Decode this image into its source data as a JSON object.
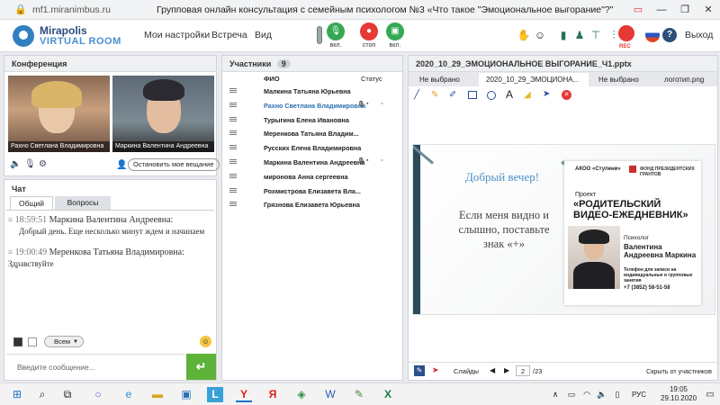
{
  "browser": {
    "url": "mf1.miranimbus.ru",
    "title": "Групповая онлайн консультация с семейным психологом №3 «Что такое \"Эмоциональное выгорание\"?\""
  },
  "app": {
    "logo_line1": "Mirapolis",
    "logo_line2": "VIRTUAL ROOM",
    "menu": [
      "Мои настройки",
      "Встреча",
      "Вид"
    ],
    "mic_label": "вкл.",
    "stop_label": "стоп",
    "cam_label": "вкл.",
    "rec_label": "REC",
    "exit_label": "Выход"
  },
  "conference": {
    "title": "Конференция",
    "videos": [
      "Рахно Светлана Владимировна",
      "Маркина Валентина Андреевна"
    ],
    "stop_broadcast": "Остановить мое вещание"
  },
  "chat": {
    "title": "Чат",
    "tabs": [
      "Общий",
      "Вопросы"
    ],
    "messages": [
      {
        "time": "18:59:51",
        "author": "Маркина Валентина  Андреевна:",
        "text": "Добрый день. Еще несколько минут ждем и начинаем"
      },
      {
        "time": "19:00:49",
        "author": "Меренкова  Татьяна Владимировна:",
        "text": "Здравствуйте"
      }
    ],
    "recipient": "Всем",
    "placeholder": "Введите сообщение..."
  },
  "participants": {
    "title": "Участники",
    "count": "9",
    "col_name": "ФИО",
    "col_status": "Статус",
    "list": [
      "Малкина Татьяна  Юрьевна",
      "Рахно Светлана  Владимировна",
      "Турыгина  Елена  Ивановна",
      "Меренкова  Татьяна  Владим...",
      "Русских Елена Владимировна",
      "Маркина Валентина  Андреевна",
      "миронова  Анна  сергеевна",
      "Рохмистрова  Елизавета Вла...",
      "Грязнова Елизавета  Юрьевна"
    ]
  },
  "presentation": {
    "title": "2020_10_29_ЭМОЦИОНАЛЬНОЕ ВЫГОРАНИЕ_Ч1.pptx",
    "tabs": [
      "Не выбрано",
      "2020_10_29_ЭМОЦИОНА...",
      "Не выбрано",
      "логотип.png"
    ],
    "slide": {
      "greeting": "Добрый вечер!",
      "body": "Если меня видно и слышно, поставьте знак «+»",
      "org1": "АКОО «Ступени»",
      "org2": "ФОНД ПРЕЗИДЕНТСКИХ ГРАНТОВ",
      "project_label": "Проект",
      "project_name": "«РОДИТЕЛЬСКИЙ ВИДЕО-ЕЖЕДНЕВНИК»",
      "role": "Психолог",
      "person": "Валентина Андреевна Маркина",
      "phone_note": "Телефон для записи на индивидуальные и групповые занятия",
      "phone": "+7 (3852) 58-51-58"
    },
    "slides_label": "Слайды",
    "page": "2",
    "total": "/23",
    "hide_label": "Скрыть от участников"
  },
  "taskbar": {
    "lang": "РУС",
    "time": "19:05",
    "date": "29.10.2020"
  },
  "colors": {
    "green": "#34a853",
    "red": "#e53935",
    "blue": "#2f6fb5",
    "link": "#2a6fb0",
    "slide_title": "#4a90c8"
  }
}
